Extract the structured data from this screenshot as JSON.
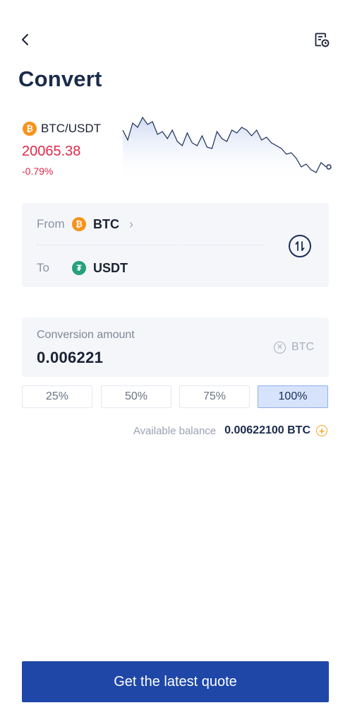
{
  "header": {
    "back_icon": "chevron-left-icon",
    "history_icon": "order-history-icon",
    "title": "Convert"
  },
  "ticker": {
    "pair": "BTC/USDT",
    "price": "20065.38",
    "change": "-0.79%",
    "change_color": "#e0294a",
    "sparkline": [
      62,
      48,
      72,
      66,
      80,
      70,
      74,
      56,
      60,
      50,
      62,
      46,
      40,
      58,
      44,
      40,
      54,
      38,
      36,
      60,
      50,
      46,
      62,
      58,
      66,
      62,
      54,
      62,
      48,
      52,
      44,
      40,
      36,
      28,
      30,
      22,
      10,
      14,
      6,
      2,
      16,
      10
    ]
  },
  "pair_card": {
    "from_label": "From",
    "from_coin": "BTC",
    "to_label": "To",
    "to_coin": "USDT",
    "swap_icon": "swap-vertical-icon"
  },
  "amount": {
    "label": "Conversion amount",
    "value": "0.006221",
    "unit": "BTC",
    "clear_icon": "clear-circle-icon"
  },
  "percentages": [
    {
      "label": "25%",
      "active": false
    },
    {
      "label": "50%",
      "active": false
    },
    {
      "label": "75%",
      "active": false
    },
    {
      "label": "100%",
      "active": true
    }
  ],
  "balance": {
    "label": "Available balance",
    "value": "0.00622100 BTC",
    "add_icon": "add-circle-icon"
  },
  "cta": {
    "label": "Get the latest quote"
  },
  "colors": {
    "brand": "#1e47a8",
    "btc": "#f7931a",
    "usdt": "#26a17b",
    "negative": "#e0294a"
  }
}
